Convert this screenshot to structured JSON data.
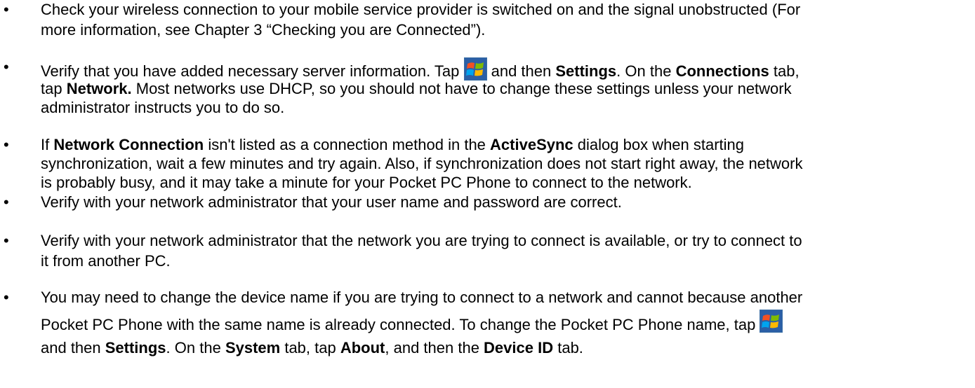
{
  "bullet_char": "•",
  "items": [
    {
      "lines": [
        [
          {
            "t": "Check your wireless connection to your mobile service provider is switched on and the signal unobstructed (For"
          }
        ],
        [
          {
            "t": "more information, see Chapter 3 “Checking you are Connected”)."
          }
        ]
      ]
    },
    {
      "lines": [
        [
          {
            "t": "Verify that you have added necessary server information. Tap "
          },
          {
            "icon": "windows-start-icon"
          },
          {
            "t": " and then "
          },
          {
            "b": "Settings"
          },
          {
            "t": ". On the "
          },
          {
            "b": "Connections"
          },
          {
            "t": " tab,"
          }
        ],
        [
          {
            "t": "tap "
          },
          {
            "b": "Network."
          },
          {
            "t": " Most networks use DHCP, so you should not have to change these settings unless your network"
          }
        ],
        [
          {
            "t": "administrator instructs you to do so."
          }
        ]
      ]
    },
    {
      "lines": [
        [
          {
            "t": "If "
          },
          {
            "b": "Network Connection"
          },
          {
            "t": " isn't listed as a connection method in the "
          },
          {
            "b": "ActiveSync"
          },
          {
            "t": " dialog box when starting"
          }
        ],
        [
          {
            "t": "synchronization, wait a few minutes and try again. Also, if synchronization does not start right away, the network"
          }
        ],
        [
          {
            "t": "is probably busy, and it may take a minute for your Pocket PC Phone to connect to the network."
          }
        ]
      ]
    },
    {
      "lines": [
        [
          {
            "t": "Verify with your network administrator that your user name and password are correct."
          }
        ]
      ]
    },
    {
      "lines": [
        [
          {
            "t": "Verify with your network administrator that the network you are trying to connect is available, or try to connect to"
          }
        ],
        [
          {
            "t": "it from another PC."
          }
        ]
      ]
    },
    {
      "lines": [
        [
          {
            "t": "You may need to change the device name if you are trying to connect to a network and cannot because another"
          }
        ],
        [
          {
            "t": "Pocket PC Phone with the same name is already connected. To change the Pocket PC Phone name, tap "
          },
          {
            "icon": "windows-start-icon"
          }
        ],
        [
          {
            "t": "and then "
          },
          {
            "b": "Settings"
          },
          {
            "t": ". On the "
          },
          {
            "b": "System"
          },
          {
            "t": " tab, tap "
          },
          {
            "b": "About"
          },
          {
            "t": ", and then the "
          },
          {
            "b": "Device ID"
          },
          {
            "t": " tab."
          }
        ]
      ]
    }
  ]
}
